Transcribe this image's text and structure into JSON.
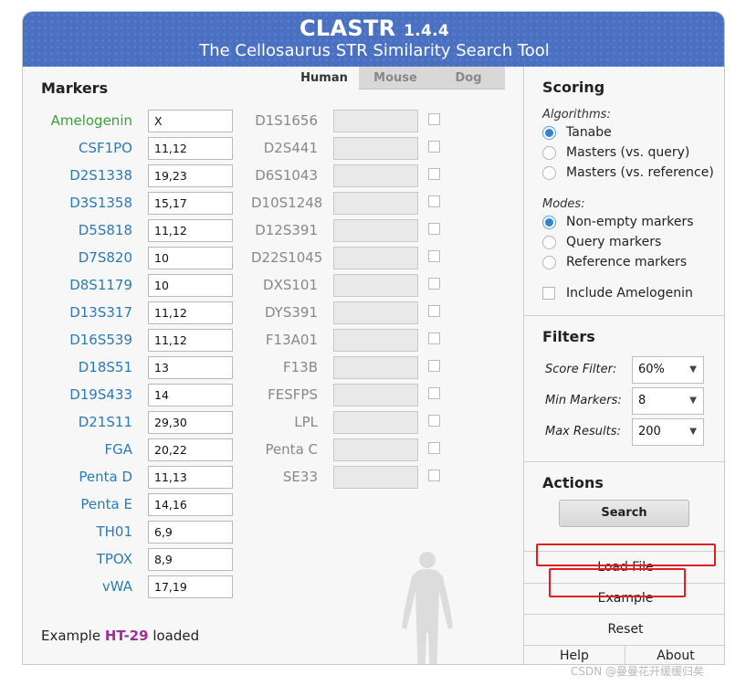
{
  "header": {
    "title": "CLASTR",
    "version": "1.4.4",
    "subtitle": "The Cellosaurus STR Similarity Search Tool"
  },
  "markers_title": "Markers",
  "species_tabs": [
    {
      "label": "Human",
      "active": true
    },
    {
      "label": "Mouse",
      "active": false
    },
    {
      "label": "Dog",
      "active": false
    }
  ],
  "markers": [
    {
      "name": "Amelogenin",
      "value": "X"
    },
    {
      "name": "CSF1PO",
      "value": "11,12"
    },
    {
      "name": "D2S1338",
      "value": "19,23"
    },
    {
      "name": "D3S1358",
      "value": "15,17"
    },
    {
      "name": "D5S818",
      "value": "11,12"
    },
    {
      "name": "D7S820",
      "value": "10"
    },
    {
      "name": "D8S1179",
      "value": "10"
    },
    {
      "name": "D13S317",
      "value": "11,12"
    },
    {
      "name": "D16S539",
      "value": "11,12"
    },
    {
      "name": "D18S51",
      "value": "13"
    },
    {
      "name": "D19S433",
      "value": "14"
    },
    {
      "name": "D21S11",
      "value": "29,30"
    },
    {
      "name": "FGA",
      "value": "20,22"
    },
    {
      "name": "Penta D",
      "value": "11,13"
    },
    {
      "name": "Penta E",
      "value": "14,16"
    },
    {
      "name": "TH01",
      "value": "6,9"
    },
    {
      "name": "TPOX",
      "value": "8,9"
    },
    {
      "name": "vWA",
      "value": "17,19"
    }
  ],
  "optional_markers": [
    {
      "name": "D1S1656"
    },
    {
      "name": "D2S441"
    },
    {
      "name": "D6S1043"
    },
    {
      "name": "D10S1248"
    },
    {
      "name": "D12S391"
    },
    {
      "name": "D22S1045"
    },
    {
      "name": "DXS101"
    },
    {
      "name": "DYS391"
    },
    {
      "name": "F13A01"
    },
    {
      "name": "F13B"
    },
    {
      "name": "FESFPS"
    },
    {
      "name": "LPL"
    },
    {
      "name": "Penta C"
    },
    {
      "name": "SE33"
    }
  ],
  "status": {
    "prefix": "Example",
    "sample": "HT-29",
    "suffix": "loaded"
  },
  "scoring": {
    "title": "Scoring",
    "algorithms_label": "Algorithms:",
    "algorithms": [
      {
        "label": "Tanabe",
        "selected": true
      },
      {
        "label": "Masters (vs. query)",
        "selected": false
      },
      {
        "label": "Masters (vs. reference)",
        "selected": false
      }
    ],
    "modes_label": "Modes:",
    "modes": [
      {
        "label": "Non-empty markers",
        "selected": true
      },
      {
        "label": "Query markers",
        "selected": false
      },
      {
        "label": "Reference markers",
        "selected": false
      }
    ],
    "include_amelogenin": {
      "label": "Include Amelogenin",
      "checked": false
    }
  },
  "filters": {
    "title": "Filters",
    "score_filter": {
      "label": "Score Filter:",
      "value": "60%"
    },
    "min_markers": {
      "label": "Min Markers:",
      "value": "8"
    },
    "max_results": {
      "label": "Max Results:",
      "value": "200"
    }
  },
  "actions": {
    "title": "Actions",
    "search": "Search",
    "load_file": "Load File",
    "example": "Example",
    "reset": "Reset",
    "help": "Help",
    "about": "About"
  },
  "colors": {
    "header_bg": "#4a70c2",
    "marker_label": "#2d7ab5",
    "amelogenin_label": "#3ba13b",
    "sample_name": "#a12d9c",
    "highlight_box": "#e02020"
  },
  "watermark": "CSDN @曼曼花开缓缓归矣"
}
